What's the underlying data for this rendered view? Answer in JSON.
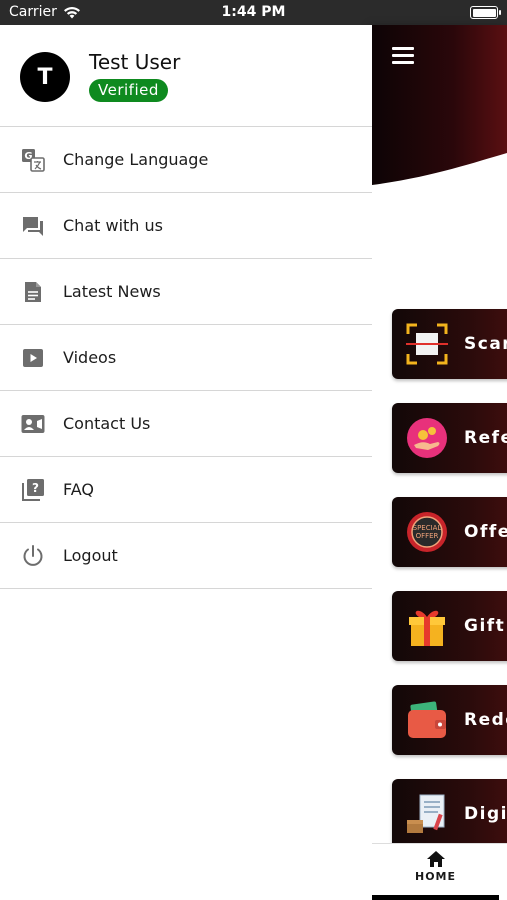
{
  "status_bar": {
    "carrier": "Carrier",
    "time": "1:44 PM"
  },
  "drawer": {
    "user": {
      "avatar_letter": "T",
      "name": "Test User",
      "badge": "Verified"
    },
    "items": [
      {
        "label": "Change Language",
        "icon": "translate-icon"
      },
      {
        "label": "Chat with us",
        "icon": "chat-icon"
      },
      {
        "label": "Latest News",
        "icon": "news-icon"
      },
      {
        "label": "Videos",
        "icon": "video-icon"
      },
      {
        "label": "Contact Us",
        "icon": "contact-card-icon"
      },
      {
        "label": "FAQ",
        "icon": "help-icon"
      },
      {
        "label": "Logout",
        "icon": "power-icon"
      }
    ]
  },
  "main": {
    "cards": [
      {
        "label": "Scar",
        "icon": "scan-icon"
      },
      {
        "label": "Refe",
        "icon": "refer-icon"
      },
      {
        "label": "Offe",
        "icon": "special-offer-icon"
      },
      {
        "label": "Gift",
        "icon": "gift-icon"
      },
      {
        "label": "Rede",
        "icon": "wallet-icon"
      },
      {
        "label": "Digit",
        "icon": "document-icon"
      }
    ],
    "bottom_nav": {
      "home_label": "HOME"
    }
  },
  "colors": {
    "card_dark": "#120808",
    "card_red": "#4a0f0f",
    "verified_green": "#0e8a1f",
    "header_red": "#5a0f12"
  }
}
